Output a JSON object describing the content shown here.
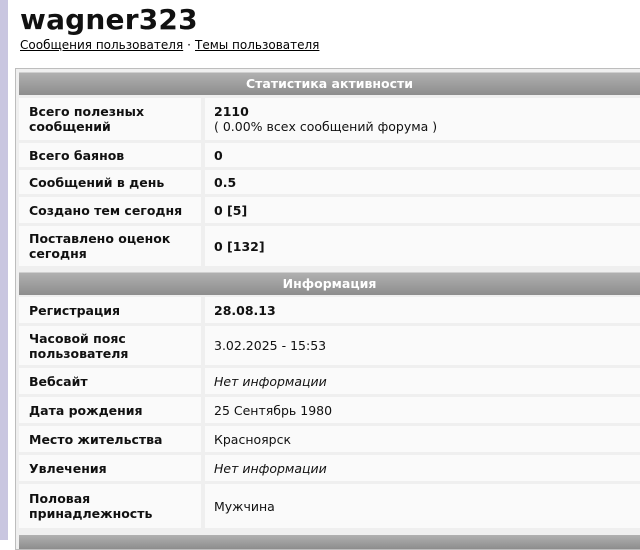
{
  "profile": {
    "username": "wagner323",
    "links": {
      "posts": "Сообщения пользователя",
      "separator": "·",
      "topics": "Темы пользователя"
    }
  },
  "activity": {
    "header": "Статистика активности",
    "rows": [
      {
        "label": "Всего полезных сообщений",
        "value": "2110",
        "sub": "( 0.00% всех сообщений форума )"
      },
      {
        "label": "Всего баянов",
        "value": "0"
      },
      {
        "label": "Сообщений в день",
        "value": "0.5"
      },
      {
        "label": "Создано тем сегодня",
        "value": "0 [5]"
      },
      {
        "label": "Поставлено оценок сегодня",
        "value": "0 [132]"
      }
    ]
  },
  "info": {
    "header": "Информация",
    "rows": [
      {
        "label": "Регистрация",
        "value": "28.08.13"
      },
      {
        "label": "Часовой пояс пользователя",
        "value": "3.02.2025 - 15:53"
      },
      {
        "label": "Вебсайт",
        "value": "Нет информации"
      },
      {
        "label": "Дата рождения",
        "value": "25 Сентябрь 1980"
      },
      {
        "label": "Место жительства",
        "value": "Красноярск"
      },
      {
        "label": "Увлечения",
        "value": "Нет информации"
      },
      {
        "label": "Половая принадлежность",
        "value": "Мужчина"
      }
    ]
  }
}
